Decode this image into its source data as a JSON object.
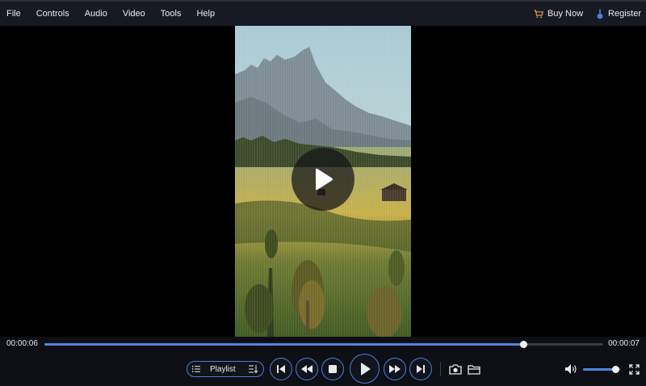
{
  "menu": {
    "items": [
      "File",
      "Controls",
      "Audio",
      "Video",
      "Tools",
      "Help"
    ],
    "buy_now": "Buy Now",
    "register": "Register"
  },
  "player": {
    "current_time": "00:00:06",
    "total_time": "00:00:07",
    "progress": 0.857,
    "volume": 0.85,
    "playlist_label": "Playlist"
  },
  "icons": {
    "buy_now": "cart-icon",
    "register": "key-icon",
    "play_overlay": "play-icon",
    "playlist": "list-icon",
    "sort": "sort-icon",
    "first": "skip-first-icon",
    "rewind": "rewind-icon",
    "stop": "stop-icon",
    "play": "play-icon",
    "forward": "fast-forward-icon",
    "last": "skip-last-icon",
    "snapshot": "camera-icon",
    "open": "folder-icon",
    "volume": "volume-icon",
    "fullscreen": "fullscreen-icon"
  },
  "colors": {
    "accent": "#4f86e0",
    "buy_icon": "#e2a23a",
    "register_icon": "#4a7fe0"
  }
}
